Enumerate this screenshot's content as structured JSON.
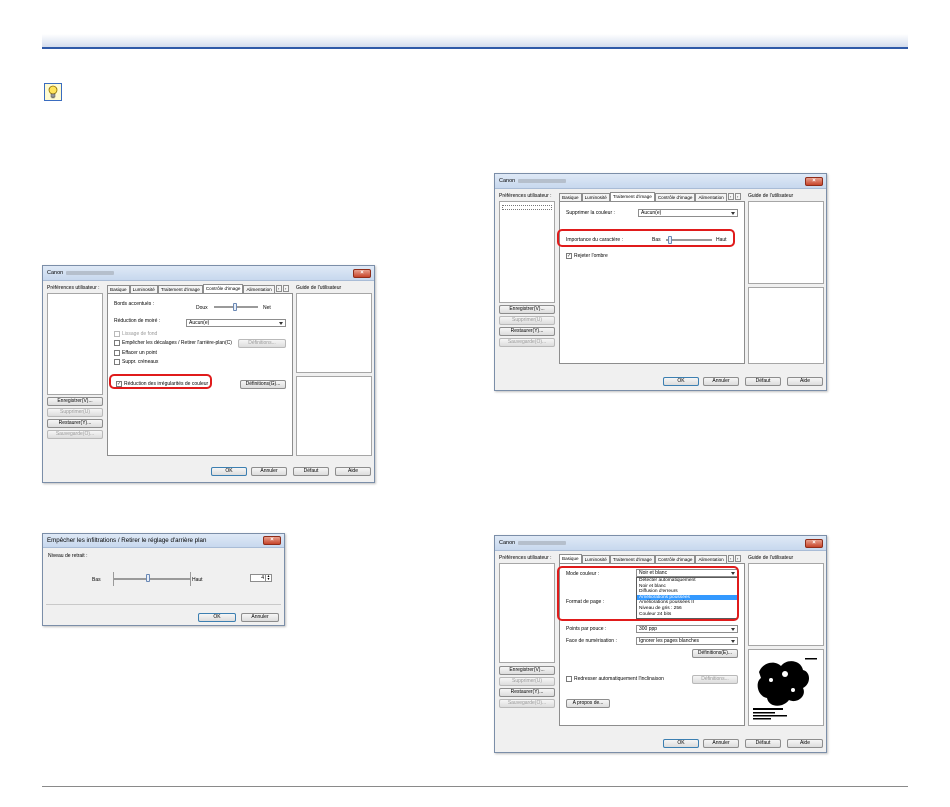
{
  "hint_icon": "lightbulb-icon",
  "common": {
    "title_prefix": "Canon",
    "close": "×",
    "prefs_label": "Préférences utilisateur :",
    "guide_label": "Guide de l'utilisateur",
    "save_label": "Enregistrer(V)...",
    "delete_label": "Supprimer(U)",
    "restore_label": "Restaurer(Y)...",
    "backup_label": "Sauvegarde(O)...",
    "ok": "OK",
    "cancel": "Annuler",
    "default": "Défaut",
    "help": "Aide"
  },
  "dlg1": {
    "tabs": [
      "Basique",
      "Luminosité",
      "Traitement d'image",
      "Contrôle d'image",
      "Alimentation"
    ],
    "active_tab": 3,
    "edge_label": "Bords accentués :",
    "edge_low": "Doux",
    "edge_high": "Net",
    "moire_label": "Réduction de moiré :",
    "moire_value": "Aucun(e)",
    "bg_smooth": "Lissage de fond",
    "prevent_bleed": "Empêcher les décalages / Retirer l'arrière-plan(C)",
    "definitions": "Définitions...",
    "erase_dot": "Effacer un point",
    "remove_notch": "Suppr. créneaux",
    "color_unevenness": "Réduction des irrégularités de couleur",
    "definitions2": "Définitions(G)..."
  },
  "dlg2": {
    "tabs": [
      "Basique",
      "Luminosité",
      "Traitement d'image",
      "Contrôle d'image",
      "Alimentation"
    ],
    "active_tab": 2,
    "drop_color_label": "Supprimer la couleur :",
    "drop_color_value": "Aucun(e)",
    "emphasis_label": "Importance du caractère :",
    "low": "Bas",
    "high": "Haut",
    "reverse_shadow": "Rejeter l'ombre"
  },
  "dlg3": {
    "title": "Empêcher les infiltrations / Retirer le réglage d'arrière plan",
    "level_label": "Niveau de retrait :",
    "low": "Bas",
    "high": "Haut",
    "value": "4",
    "ok": "OK",
    "cancel": "Annuler"
  },
  "dlg4": {
    "tabs": [
      "Basique",
      "Luminosité",
      "Traitement d'image",
      "Contrôle d'image",
      "Alimentation"
    ],
    "active_tab": 0,
    "mode_label": "Mode couleur :",
    "mode_value": "Noir et blanc",
    "mode_options": [
      "Détecter automatiquement",
      "Noir et blanc",
      "Diffusion d'erreurs",
      "Améliorations poussées",
      "Améliorations poussées II",
      "Niveau de gris : 256",
      "Couleur 24 bits"
    ],
    "selected_option": 3,
    "page_size_label": "Format de page :",
    "dpi_label": "Points par pouce :",
    "dpi_value": "300 ppp",
    "scan_side_label": "Face de numérisation :",
    "scan_side_value": "Ignorer les pages blanches",
    "definitions": "Définitions(E)...",
    "deskew": "Redresser automatiquement l'inclinaison",
    "deskew_btn": "Définitions...",
    "about": "A propos de..."
  }
}
